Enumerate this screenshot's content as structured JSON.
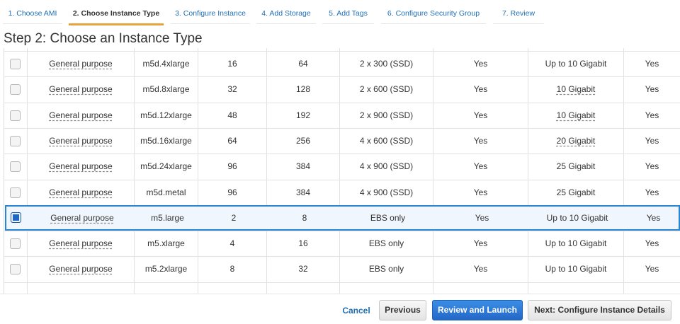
{
  "wizard": {
    "steps": [
      "1. Choose AMI",
      "2. Choose Instance Type",
      "3. Configure Instance",
      "4. Add Storage",
      "5. Add Tags",
      "6. Configure Security Group",
      "7. Review"
    ],
    "active_step": 1
  },
  "page_title": "Step 2: Choose an Instance Type",
  "instances": [
    {
      "family": "General purpose",
      "type": "m5d.4xlarge",
      "vcpus": "16",
      "memory": "64",
      "storage": "2 x 300 (SSD)",
      "ebs_optimized": "Yes",
      "network": "Up to 10 Gigabit",
      "ipv6": "Yes",
      "selected": false
    },
    {
      "family": "General purpose",
      "type": "m5d.8xlarge",
      "vcpus": "32",
      "memory": "128",
      "storage": "2 x 600 (SSD)",
      "ebs_optimized": "Yes",
      "network": "10 Gigabit",
      "ipv6": "Yes",
      "selected": false
    },
    {
      "family": "General purpose",
      "type": "m5d.12xlarge",
      "vcpus": "48",
      "memory": "192",
      "storage": "2 x 900 (SSD)",
      "ebs_optimized": "Yes",
      "network": "10 Gigabit",
      "ipv6": "Yes",
      "selected": false
    },
    {
      "family": "General purpose",
      "type": "m5d.16xlarge",
      "vcpus": "64",
      "memory": "256",
      "storage": "4 x 600 (SSD)",
      "ebs_optimized": "Yes",
      "network": "20 Gigabit",
      "ipv6": "Yes",
      "selected": false
    },
    {
      "family": "General purpose",
      "type": "m5d.24xlarge",
      "vcpus": "96",
      "memory": "384",
      "storage": "4 x 900 (SSD)",
      "ebs_optimized": "Yes",
      "network": "25 Gigabit",
      "ipv6": "Yes",
      "selected": false
    },
    {
      "family": "General purpose",
      "type": "m5d.metal",
      "vcpus": "96",
      "memory": "384",
      "storage": "4 x 900 (SSD)",
      "ebs_optimized": "Yes",
      "network": "25 Gigabit",
      "ipv6": "Yes",
      "selected": false
    },
    {
      "family": "General purpose",
      "type": "m5.large",
      "vcpus": "2",
      "memory": "8",
      "storage": "EBS only",
      "ebs_optimized": "Yes",
      "network": "Up to 10 Gigabit",
      "ipv6": "Yes",
      "selected": true
    },
    {
      "family": "General purpose",
      "type": "m5.xlarge",
      "vcpus": "4",
      "memory": "16",
      "storage": "EBS only",
      "ebs_optimized": "Yes",
      "network": "Up to 10 Gigabit",
      "ipv6": "Yes",
      "selected": false
    },
    {
      "family": "General purpose",
      "type": "m5.2xlarge",
      "vcpus": "8",
      "memory": "32",
      "storage": "EBS only",
      "ebs_optimized": "Yes",
      "network": "Up to 10 Gigabit",
      "ipv6": "Yes",
      "selected": false
    }
  ],
  "footer": {
    "cancel": "Cancel",
    "previous": "Previous",
    "review_launch": "Review and Launch",
    "next": "Next: Configure Instance Details"
  },
  "colors": {
    "accent": "#2a86d3",
    "active_tab": "#e7a23c",
    "primary_button": "#2467c8",
    "link": "#1f6fb5"
  }
}
